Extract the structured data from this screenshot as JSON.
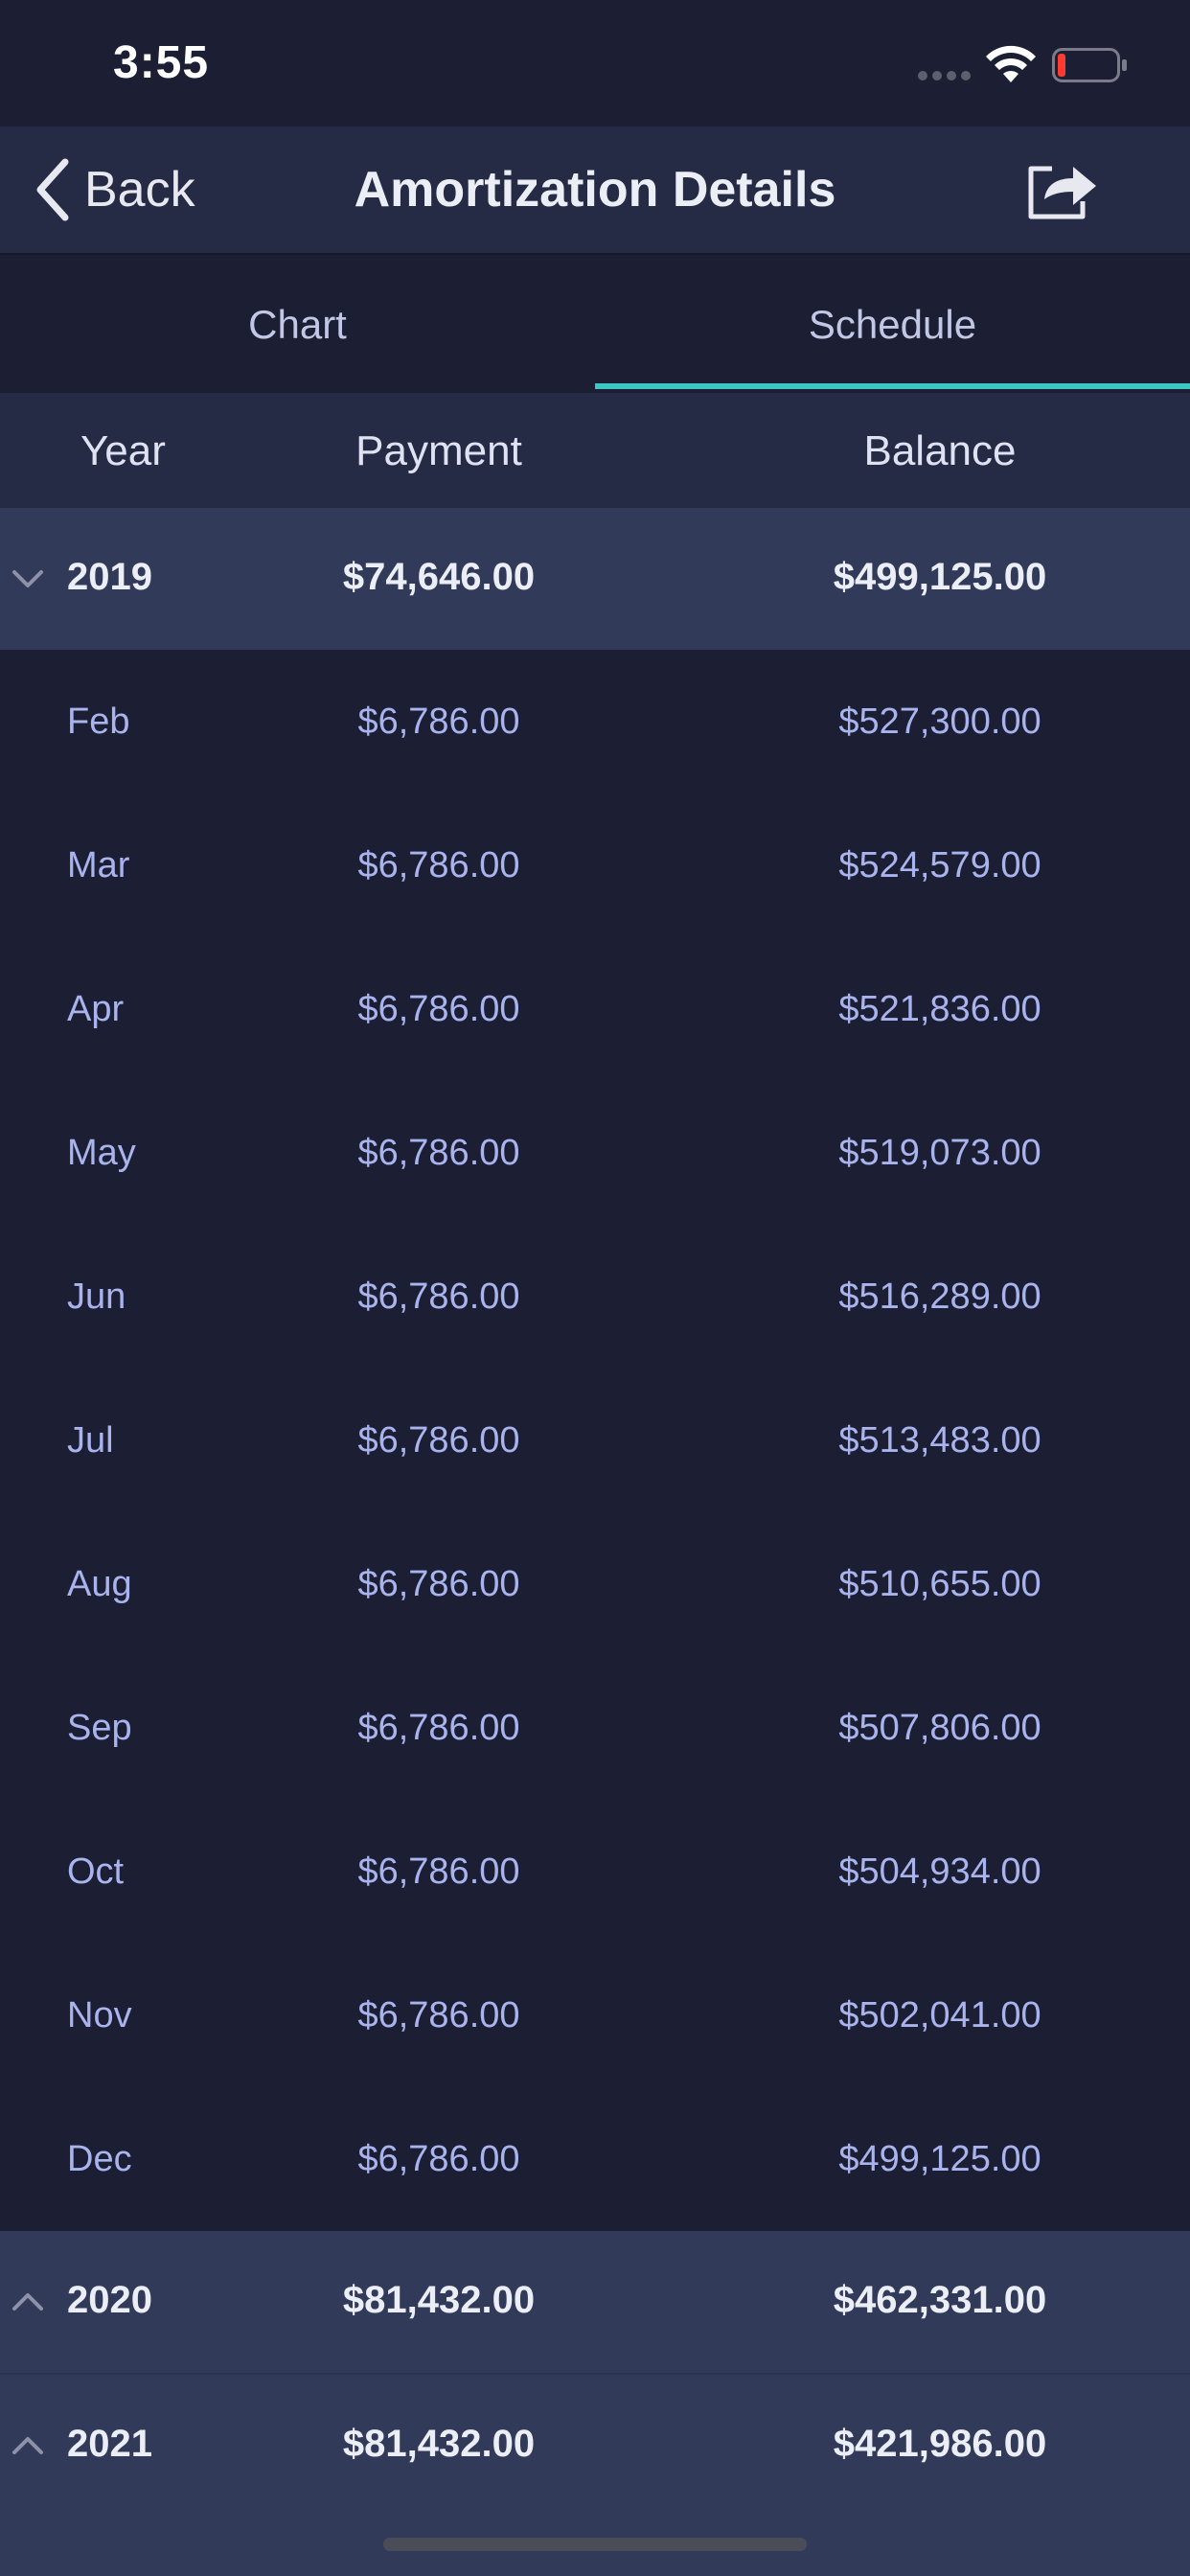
{
  "status_bar": {
    "time": "3:55"
  },
  "nav": {
    "back_label": "Back",
    "title": "Amortization Details",
    "share_icon": "share-icon"
  },
  "tabs": [
    {
      "label": "Chart",
      "selected": false
    },
    {
      "label": "Schedule",
      "selected": true
    }
  ],
  "columns": {
    "year": "Year",
    "payment": "Payment",
    "balance": "Balance"
  },
  "colors": {
    "background": "#1c1f33",
    "bar": "#262b45",
    "year_row": "#323a5a",
    "accent": "#3bc7c4",
    "month_text": "#a9b4ee"
  },
  "schedule": [
    {
      "year": "2019",
      "payment": "$74,646.00",
      "balance": "$499,125.00",
      "expanded": true,
      "months": [
        {
          "month": "Feb",
          "payment": "$6,786.00",
          "balance": "$527,300.00"
        },
        {
          "month": "Mar",
          "payment": "$6,786.00",
          "balance": "$524,579.00"
        },
        {
          "month": "Apr",
          "payment": "$6,786.00",
          "balance": "$521,836.00"
        },
        {
          "month": "May",
          "payment": "$6,786.00",
          "balance": "$519,073.00"
        },
        {
          "month": "Jun",
          "payment": "$6,786.00",
          "balance": "$516,289.00"
        },
        {
          "month": "Jul",
          "payment": "$6,786.00",
          "balance": "$513,483.00"
        },
        {
          "month": "Aug",
          "payment": "$6,786.00",
          "balance": "$510,655.00"
        },
        {
          "month": "Sep",
          "payment": "$6,786.00",
          "balance": "$507,806.00"
        },
        {
          "month": "Oct",
          "payment": "$6,786.00",
          "balance": "$504,934.00"
        },
        {
          "month": "Nov",
          "payment": "$6,786.00",
          "balance": "$502,041.00"
        },
        {
          "month": "Dec",
          "payment": "$6,786.00",
          "balance": "$499,125.00"
        }
      ]
    },
    {
      "year": "2020",
      "payment": "$81,432.00",
      "balance": "$462,331.00",
      "expanded": false,
      "months": []
    },
    {
      "year": "2021",
      "payment": "$81,432.00",
      "balance": "$421,986.00",
      "expanded": false,
      "months": []
    }
  ]
}
